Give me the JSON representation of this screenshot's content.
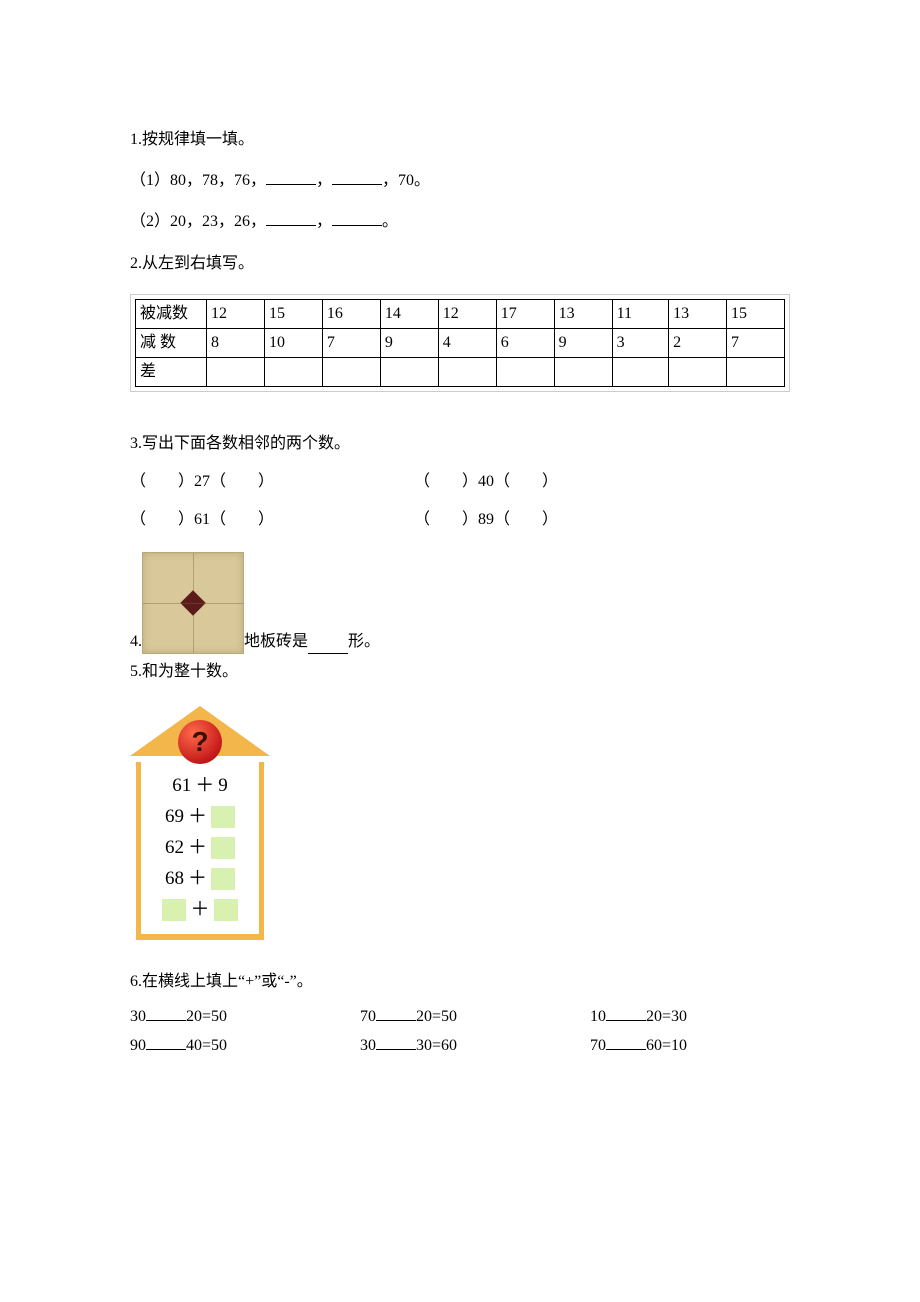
{
  "q1": {
    "title": "1.按规律填一填。",
    "line1_prefix": "（1）80，78，76，",
    "line1_mid": "，",
    "line1_suffix": "，70。",
    "line2_prefix": "（2）20，23，26，",
    "line2_mid": "，",
    "line2_suffix": "。"
  },
  "q2": {
    "title": "2.从左到右填写。",
    "labels": [
      "被减数",
      "减  数",
      "差"
    ],
    "minuend": [
      "12",
      "15",
      "16",
      "14",
      "12",
      "17",
      "13",
      "11",
      "13",
      "15"
    ],
    "subtrahend": [
      "8",
      "10",
      "7",
      "9",
      "4",
      "6",
      "9",
      "3",
      "2",
      "7"
    ]
  },
  "q3": {
    "title": "3.写出下面各数相邻的两个数。",
    "values": [
      "27",
      "40",
      "61",
      "89"
    ]
  },
  "q4": {
    "prefix": "4.",
    "mid": "地板砖是",
    "suffix": "形。"
  },
  "q5": {
    "title": "5.和为整十数。",
    "roof_symbol": "?",
    "rows": [
      {
        "left": "61",
        "op": "＋",
        "right": "9",
        "right_is_box": false,
        "left_is_box": false
      },
      {
        "left": "69",
        "op": "＋",
        "right": "",
        "right_is_box": true,
        "left_is_box": false
      },
      {
        "left": "62",
        "op": "＋",
        "right": "",
        "right_is_box": true,
        "left_is_box": false
      },
      {
        "left": "68",
        "op": "＋",
        "right": "",
        "right_is_box": true,
        "left_is_box": false
      },
      {
        "left": "",
        "op": "＋",
        "right": "",
        "right_is_box": true,
        "left_is_box": true
      }
    ]
  },
  "q6": {
    "title": "6.在横线上填上“+”或“-”。",
    "items": [
      {
        "a": "30",
        "b": "20",
        "r": "50"
      },
      {
        "a": "70",
        "b": "20",
        "r": "50"
      },
      {
        "a": "10",
        "b": "20",
        "r": "30"
      },
      {
        "a": "90",
        "b": "40",
        "r": "50"
      },
      {
        "a": "30",
        "b": "30",
        "r": "60"
      },
      {
        "a": "70",
        "b": "60",
        "r": "10"
      }
    ]
  }
}
